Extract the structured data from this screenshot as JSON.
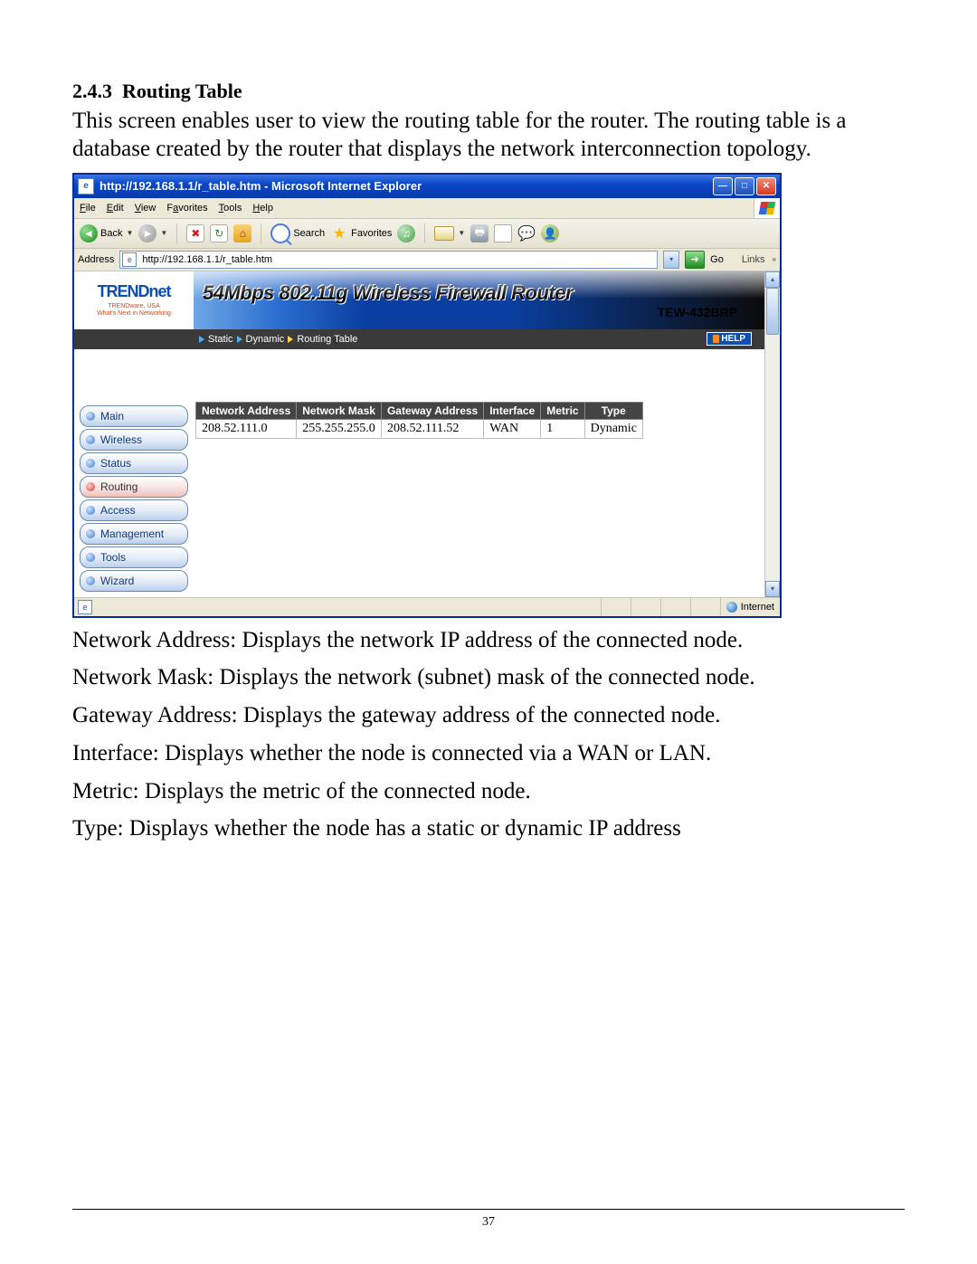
{
  "doc": {
    "section_number": "2.4.3",
    "section_title": "Routing Table",
    "intro": "This screen enables user to view the routing table for the router. The routing table is a database created by the router that displays the network interconnection topology.",
    "after": [
      "Network Address: Displays the network IP address of the connected node.",
      "Network Mask: Displays the network (subnet) mask of the connected node.",
      "Gateway Address: Displays the gateway address of the connected node.",
      "Interface: Displays whether the node is connected via a WAN or LAN.",
      "Metric: Displays the metric of the connected node.",
      "Type: Displays whether the node has a static or dynamic IP address"
    ],
    "page_number": "37"
  },
  "ie": {
    "title": "http://192.168.1.1/r_table.htm - Microsoft Internet Explorer",
    "menu": {
      "file": "File",
      "edit": "Edit",
      "view": "View",
      "favorites": "Favorites",
      "tools": "Tools",
      "help": "Help"
    },
    "toolbar": {
      "back": "Back",
      "search": "Search",
      "favorites": "Favorites"
    },
    "address": {
      "label": "Address",
      "value": "http://192.168.1.1/r_table.htm",
      "go": "Go",
      "links": "Links"
    },
    "status": {
      "zone": "Internet"
    }
  },
  "router": {
    "brand": "TRENDnet",
    "brand_sub1": "TRENDware, USA",
    "brand_sub2": "What's Next in Networking",
    "banner_line1": "54Mbps 802.11g Wireless Firewall Router",
    "banner_line2": "TEW-432BRP",
    "subnav": {
      "static": "Static",
      "dynamic": "Dynamic",
      "routing_table": "Routing Table",
      "help": "HELP"
    },
    "sidemenu": [
      "Main",
      "Wireless",
      "Status",
      "Routing",
      "Access",
      "Management",
      "Tools",
      "Wizard"
    ],
    "sidemenu_active_index": 3,
    "table": {
      "headers": [
        "Network Address",
        "Network Mask",
        "Gateway Address",
        "Interface",
        "Metric",
        "Type"
      ],
      "rows": [
        {
          "net": "208.52.111.0",
          "mask": "255.255.255.0",
          "gw": "208.52.111.52",
          "if": "WAN",
          "metric": "1",
          "type": "Dynamic"
        }
      ]
    }
  }
}
